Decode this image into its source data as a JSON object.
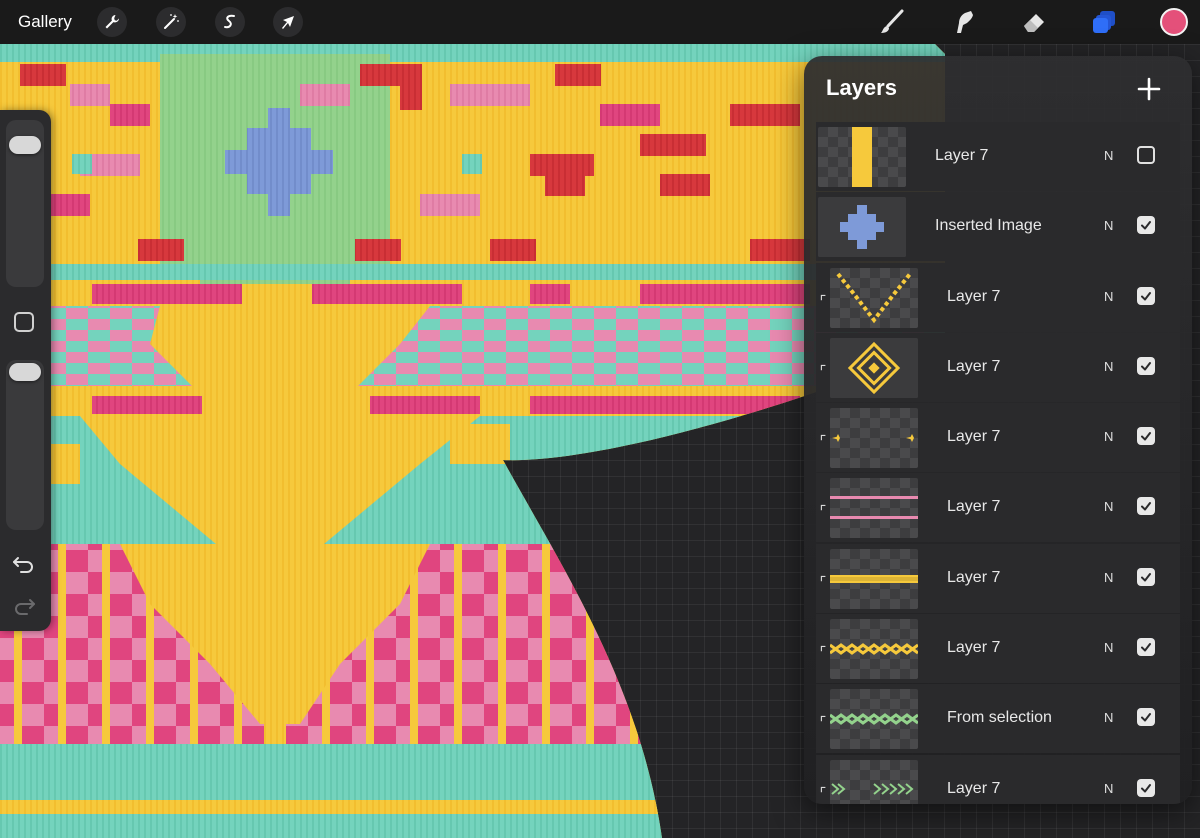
{
  "app": {
    "gallery_label": "Gallery",
    "current_color": "#e4507a",
    "active_tool_color": "#2f6ef7"
  },
  "toolbar": {
    "left_tools": [
      {
        "icon": "wrench-icon",
        "name": "actions"
      },
      {
        "icon": "magic-wand-icon",
        "name": "adjustments"
      },
      {
        "icon": "selection-s-icon",
        "name": "selection"
      },
      {
        "icon": "arrow-cursor-icon",
        "name": "transform"
      }
    ],
    "right_tools": [
      {
        "icon": "brush-icon",
        "name": "brush"
      },
      {
        "icon": "smudge-icon",
        "name": "smudge"
      },
      {
        "icon": "eraser-icon",
        "name": "eraser"
      },
      {
        "icon": "layers-icon",
        "name": "layers"
      }
    ]
  },
  "sidebar": {
    "brush_size_level": 0.05,
    "opacity_level": 0.05,
    "undo_icon": "undo-icon",
    "redo_icon": "redo-icon"
  },
  "layers_panel": {
    "title": "Layers",
    "add_icon": "plus-icon",
    "layers": [
      {
        "name": "Layer 7",
        "blend": "N",
        "visible": false,
        "clipped": false,
        "thumb": "yellow-bar"
      },
      {
        "name": "Inserted Image",
        "blend": "N",
        "visible": true,
        "clipped": false,
        "thumb": "blue-cross"
      },
      {
        "name": "Layer 7",
        "blend": "N",
        "visible": true,
        "clipped": true,
        "thumb": "yellow-chevron"
      },
      {
        "name": "Layer 7",
        "blend": "N",
        "visible": true,
        "clipped": true,
        "thumb": "gold-diamond"
      },
      {
        "name": "Layer 7",
        "blend": "N",
        "visible": true,
        "clipped": true,
        "thumb": "sparkles"
      },
      {
        "name": "Layer 7",
        "blend": "N",
        "visible": true,
        "clipped": true,
        "thumb": "pink-lines"
      },
      {
        "name": "Layer 7",
        "blend": "N",
        "visible": true,
        "clipped": true,
        "thumb": "yellow-check-band"
      },
      {
        "name": "Layer 7",
        "blend": "N",
        "visible": true,
        "clipped": true,
        "thumb": "yellow-zigzag"
      },
      {
        "name": "From selection",
        "blend": "N",
        "visible": true,
        "clipped": true,
        "thumb": "green-zigzag"
      },
      {
        "name": "Layer 7",
        "blend": "N",
        "visible": true,
        "clipped": true,
        "thumb": "green-arrows"
      }
    ]
  },
  "colors": {
    "yellow": "#f6c93c",
    "pink": "#e0457f",
    "light_pink": "#e88ab0",
    "teal": "#74d3bd",
    "green": "#93d28c",
    "red": "#d7383d",
    "blue": "#7e9ad8"
  }
}
